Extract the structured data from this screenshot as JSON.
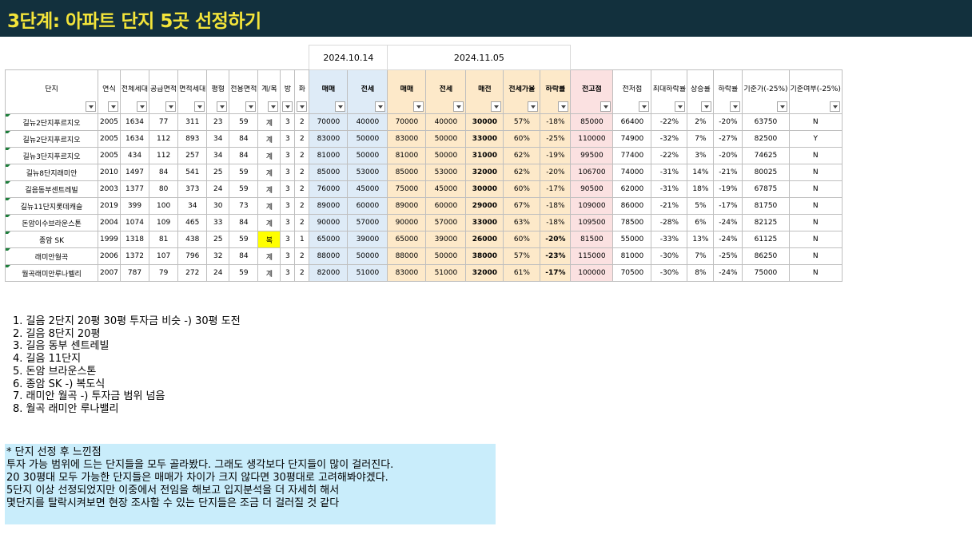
{
  "page": {
    "title": "3단계: 아파트 단지 5곳 선정하기"
  },
  "dates": {
    "first": "2024.10.14",
    "second": "2024.11.05"
  },
  "headers": [
    "단지",
    "연식",
    "전체세대",
    "공급면적",
    "면적세대",
    "평형",
    "전용면적",
    "계/복",
    "방",
    "화",
    "매매",
    "전세",
    "매매",
    "전세",
    "매전",
    "전세가율",
    "하락률",
    "전고점",
    "전저점",
    "최대하락률",
    "상승률",
    "하락률",
    "기준가(-25%)",
    "기준여부(-25%)"
  ],
  "rows": [
    [
      "길뉴2단지푸르지오",
      "2005",
      "1634",
      "77",
      "311",
      "23",
      "59",
      "계",
      "3",
      "2",
      "70000",
      "40000",
      "70000",
      "40000",
      "30000",
      "57%",
      "-18%",
      "85000",
      "66400",
      "-22%",
      "2%",
      "-20%",
      "63750",
      "N"
    ],
    [
      "길뉴2단지푸르지오",
      "2005",
      "1634",
      "112",
      "893",
      "34",
      "84",
      "계",
      "3",
      "2",
      "83000",
      "50000",
      "83000",
      "50000",
      "33000",
      "60%",
      "-25%",
      "110000",
      "74900",
      "-32%",
      "7%",
      "-27%",
      "82500",
      "Y"
    ],
    [
      "길뉴3단지푸르지오",
      "2005",
      "434",
      "112",
      "257",
      "34",
      "84",
      "계",
      "3",
      "2",
      "81000",
      "50000",
      "81000",
      "50000",
      "31000",
      "62%",
      "-19%",
      "99500",
      "77400",
      "-22%",
      "3%",
      "-20%",
      "74625",
      "N"
    ],
    [
      "길뉴8단지래미안",
      "2010",
      "1497",
      "84",
      "541",
      "25",
      "59",
      "계",
      "3",
      "2",
      "85000",
      "53000",
      "85000",
      "53000",
      "32000",
      "62%",
      "-20%",
      "106700",
      "74000",
      "-31%",
      "14%",
      "-21%",
      "80025",
      "N"
    ],
    [
      "길음동부센트레빌",
      "2003",
      "1377",
      "80",
      "373",
      "24",
      "59",
      "계",
      "3",
      "2",
      "76000",
      "45000",
      "75000",
      "45000",
      "30000",
      "60%",
      "-17%",
      "90500",
      "62000",
      "-31%",
      "18%",
      "-19%",
      "67875",
      "N"
    ],
    [
      "길뉴11단지롯데캐슬",
      "2019",
      "399",
      "100",
      "34",
      "30",
      "73",
      "계",
      "3",
      "2",
      "89000",
      "60000",
      "89000",
      "60000",
      "29000",
      "67%",
      "-18%",
      "109000",
      "86000",
      "-21%",
      "5%",
      "-17%",
      "81750",
      "N"
    ],
    [
      "돈암이수브라운스톤",
      "2004",
      "1074",
      "109",
      "465",
      "33",
      "84",
      "계",
      "3",
      "2",
      "90000",
      "57000",
      "90000",
      "57000",
      "33000",
      "63%",
      "-18%",
      "109500",
      "78500",
      "-28%",
      "6%",
      "-24%",
      "82125",
      "N"
    ],
    [
      "종암 SK",
      "1999",
      "1318",
      "81",
      "438",
      "25",
      "59",
      "복",
      "3",
      "1",
      "65000",
      "39000",
      "65000",
      "39000",
      "26000",
      "60%",
      "-20%",
      "81500",
      "55000",
      "-33%",
      "13%",
      "-24%",
      "61125",
      "N"
    ],
    [
      "래미안월곡",
      "2006",
      "1372",
      "107",
      "796",
      "32",
      "84",
      "계",
      "3",
      "2",
      "88000",
      "50000",
      "88000",
      "50000",
      "38000",
      "57%",
      "-23%",
      "115000",
      "81000",
      "-30%",
      "7%",
      "-25%",
      "86250",
      "N"
    ],
    [
      "월곡래미안루나벨리",
      "2007",
      "787",
      "79",
      "272",
      "24",
      "59",
      "계",
      "3",
      "2",
      "82000",
      "51000",
      "83000",
      "51000",
      "32000",
      "61%",
      "-17%",
      "100000",
      "70500",
      "-30%",
      "8%",
      "-24%",
      "75000",
      "N"
    ]
  ],
  "notes": [
    "1.  길음 2단지 20평 30평 투자금 비슷 -) 30평 도전",
    "2.  길음 8단지 20평",
    "3.  길음 동부 센트레빌",
    "4.  길음 11단지",
    "5.  돈암 브라운스톤",
    "6.  종암 SK -) 복도식",
    "7.  래미안 월곡 -) 투자금 범위 넘음",
    "8.  월곡 래미안 루나밸리"
  ],
  "impression": {
    "heading": "* 단지 선정 후 느낀점",
    "lines": [
      "투자 가능 범위에 드는 단지들을 모두 골라봤다. 그래도 생각보다 단지들이 많이 걸러진다.",
      "20 30평대 모두 가능한 단지들은 매매가 차이가 크지 않다면 30평대로 고려해봐야겠다.",
      "5단지 이상 선정되었지만 이중에서 전임을 해보고 입지분석을 더 자세히 해서",
      "몇단지를 탈락시켜보면 현장 조사할 수 있는 단지들은 조금 더 걸러질 것 같다"
    ]
  },
  "colors": {
    "title_bar": "#12303d",
    "title_text": "#f3e43a",
    "past_price_bg": "#deebf7",
    "current_price_bg": "#fde9c9",
    "peak_bg": "#fbe1e1",
    "highlight": "#ffff00",
    "impression_bg": "#c9edfb"
  }
}
